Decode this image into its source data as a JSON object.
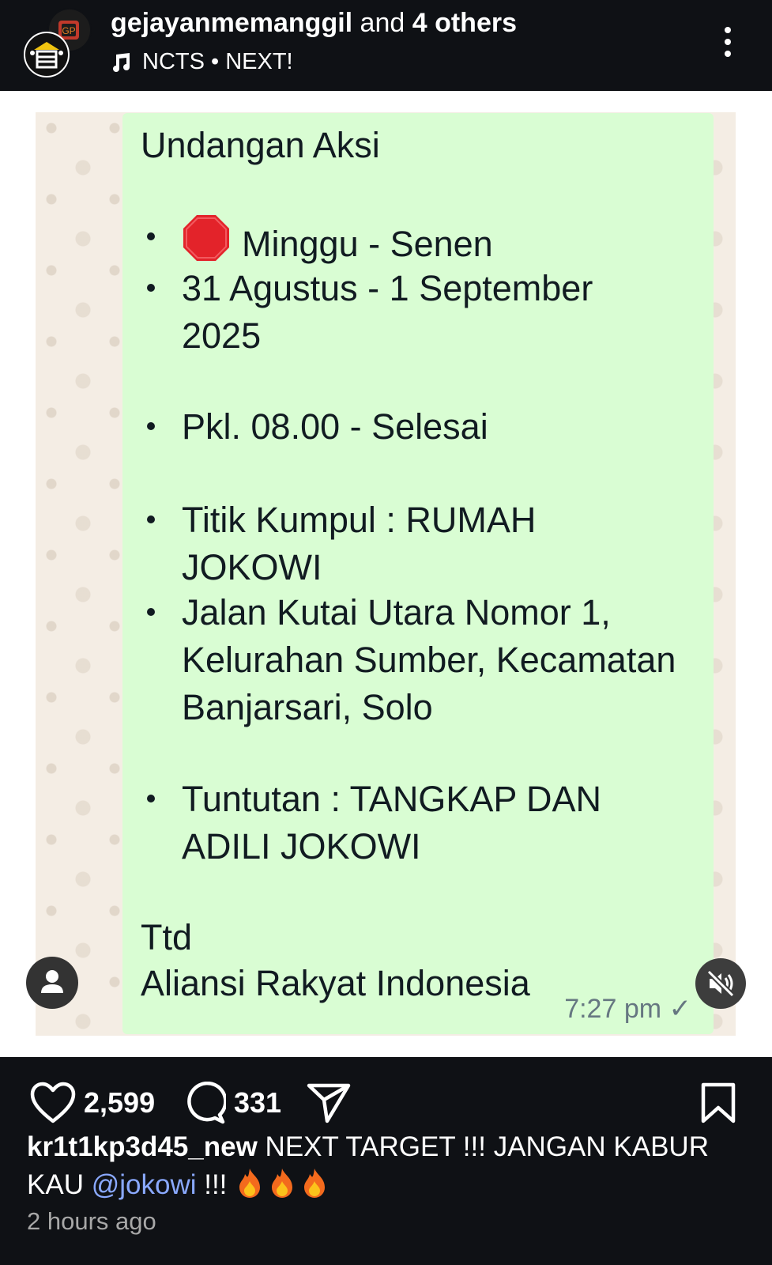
{
  "header": {
    "account": "gejayanmemanggil",
    "and_text": " and ",
    "others": "4 others",
    "music": "NCTS • NEXT!"
  },
  "message": {
    "title": "Undangan Aksi",
    "bullets": [
      "Minggu - Senen",
      "31 Agustus - 1 September 2025",
      "Pkl. 08.00 - Selesai",
      "Titik Kumpul : RUMAH JOKOWI",
      "Jalan Kutai Utara Nomor 1, Kelurahan Sumber, Kecamatan Banjarsari, Solo",
      "Tuntutan : TANGKAP DAN ADILI JOKOWI"
    ],
    "signoff_1": "Ttd",
    "signoff_2": "Aliansi Rakyat Indonesia",
    "time": "7:27 pm ✓"
  },
  "actions": {
    "likes": "2,599",
    "comments": "331"
  },
  "caption": {
    "user": "kr1t1kp3d45_new",
    "text_1": " NEXT TARGET !!! JANGAN KABUR KAU ",
    "mention": "@jokowi",
    "text_2": " !!! "
  },
  "time_ago": "2 hours ago",
  "icons": [
    "music-note-icon",
    "more-icon",
    "stop-sign-icon",
    "user-icon",
    "mute-icon",
    "heart-icon",
    "comment-icon",
    "share-icon",
    "bookmark-icon",
    "fire-icon"
  ],
  "colors": {
    "bubble": "#d9fdd3",
    "chat_bg": "#f4ede4",
    "mention": "#8aa9ff"
  }
}
